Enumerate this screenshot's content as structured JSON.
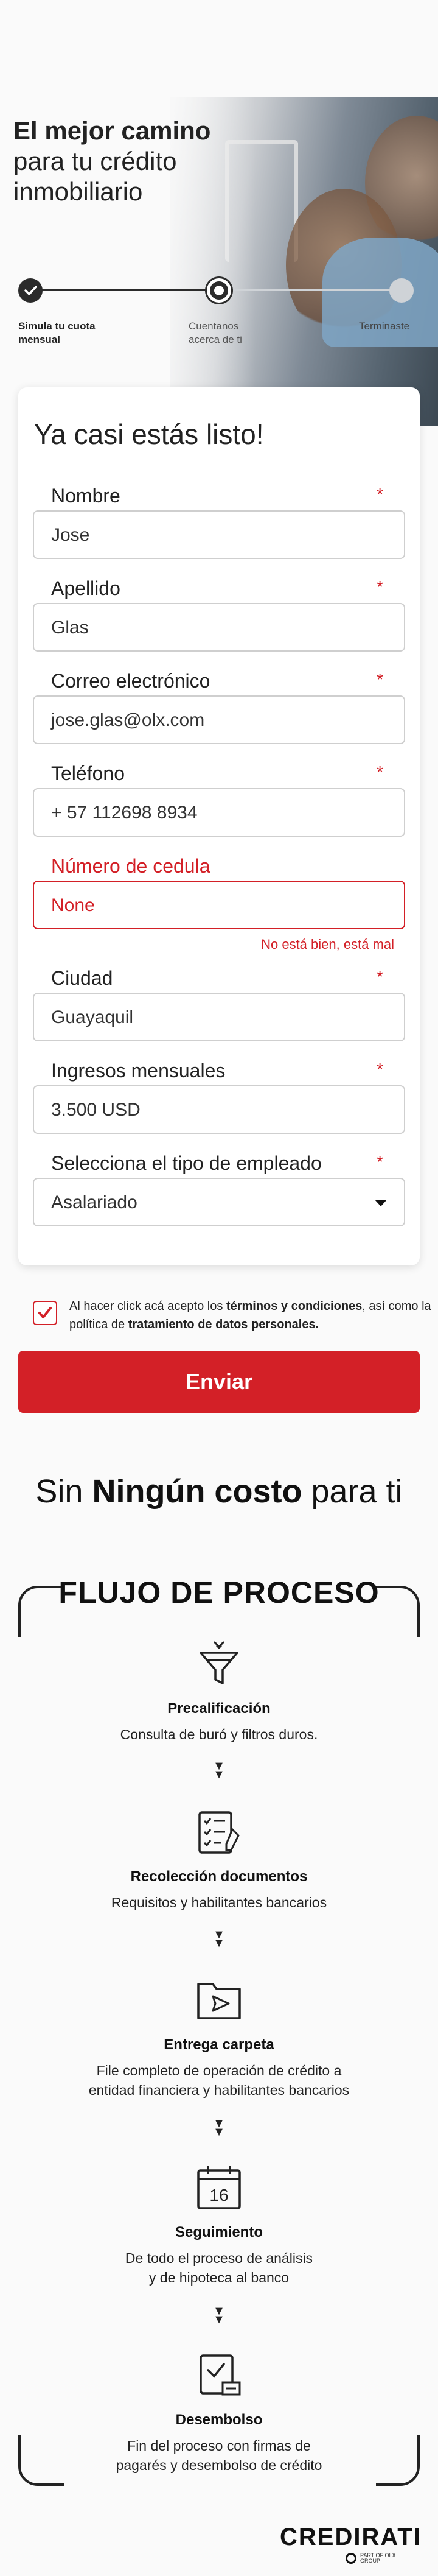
{
  "hero": {
    "title_bold": "El mejor camino",
    "title_light": "para tu crédito inmobiliario"
  },
  "stepper": {
    "steps": [
      {
        "label": "Simula tu cuota mensual",
        "state": "done"
      },
      {
        "label": "Cuentanos acerca de ti",
        "state": "current"
      },
      {
        "label": "Terminaste",
        "state": "todo"
      }
    ]
  },
  "form": {
    "title": "Ya casi estás listo!",
    "required_mark": "*",
    "fields": [
      {
        "label": "Nombre",
        "value": "Jose"
      },
      {
        "label": "Apellido",
        "value": "Glas"
      },
      {
        "label": "Correo electrónico",
        "value": "jose.glas@olx.com"
      },
      {
        "label": "Teléfono",
        "value": "+ 57 112698 8934"
      },
      {
        "label": "Número de cedula",
        "value": "None",
        "error": "No está bien, está mal"
      },
      {
        "label": "Ciudad",
        "value": "Guayaquil"
      },
      {
        "label": "Ingresos mensuales",
        "value": "3.500 USD"
      },
      {
        "label": "Selecciona el tipo de empleado",
        "value": "Asalariado"
      }
    ]
  },
  "consent": {
    "checked": true,
    "text_1": "Al hacer click acá acepto los ",
    "terms": "términos y condiciones",
    "text_2": ", así como la política de ",
    "privacy": "tratamiento de datos personales."
  },
  "submit_label": "Enviar",
  "promo": {
    "prefix": "Sin",
    "bold": "Ningún costo",
    "suffix": "para ti"
  },
  "flow": {
    "title": "FLUJO DE PROCESO",
    "arrow": "▼\n▼",
    "steps": [
      {
        "name": "Precalificación",
        "desc": "Consulta de buró y filtros duros.",
        "icon": "funnel-icon"
      },
      {
        "name": "Recolección documentos",
        "desc": "Requisitos y habilitantes bancarios",
        "icon": "checklist-icon"
      },
      {
        "name": "Entrega carpeta",
        "desc": "File completo de operación de crédito a entidad financiera y habilitantes bancarios",
        "icon": "folder-send-icon"
      },
      {
        "name": "Seguimiento",
        "desc": "De todo el proceso de análisis y de hipoteca al banco",
        "icon": "calendar-icon",
        "calendar_day": "16"
      },
      {
        "name": "Desembolso",
        "desc": "Fin del proceso con firmas de pagarés y desembolso de crédito",
        "icon": "approval-icon"
      }
    ]
  },
  "footer": {
    "brand": "CREDIRATI",
    "tagline": "PART OF OLX GROUP"
  },
  "colors": {
    "brand_red": "#d32027",
    "text_dark": "#222222",
    "border": "#cfcfcf"
  }
}
